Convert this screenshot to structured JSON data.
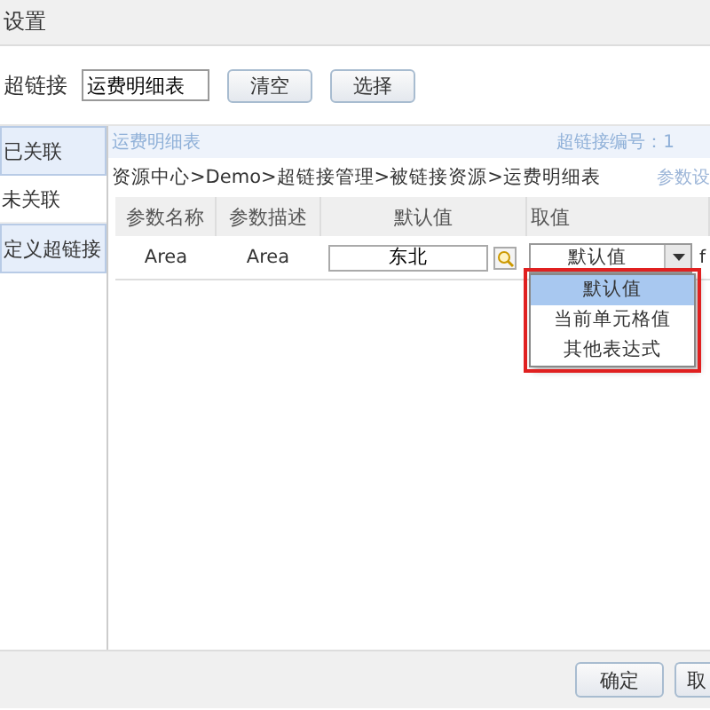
{
  "window": {
    "title": "设置"
  },
  "link": {
    "label": "超链接",
    "value": "运费明细表",
    "buttons": [
      "清空",
      "选择"
    ]
  },
  "sidebar": {
    "items": [
      {
        "label": "已关联",
        "selected": true
      },
      {
        "label": "未关联",
        "selected": false
      },
      {
        "label": "定义超链接",
        "selected": true
      }
    ]
  },
  "panel": {
    "title": "运费明细表",
    "link_number": "超链接编号：1",
    "breadcrumb": "资源中心>Demo>超链接管理>被链接资源>运费明细表",
    "side_link": "参数设"
  },
  "table": {
    "columns": [
      "参数名称",
      "参数描述",
      "默认值",
      "取值"
    ],
    "rows": [
      {
        "name": "Area",
        "description": "Area",
        "default": "东北",
        "value": "默认值",
        "extra": "f"
      }
    ]
  },
  "dropdown": {
    "options": [
      {
        "label": "默认值",
        "selected": true
      },
      {
        "label": "当前单元格值",
        "selected": false
      },
      {
        "label": "其他表达式",
        "selected": false
      }
    ]
  },
  "footer": {
    "buttons": [
      "确定",
      "取"
    ]
  }
}
